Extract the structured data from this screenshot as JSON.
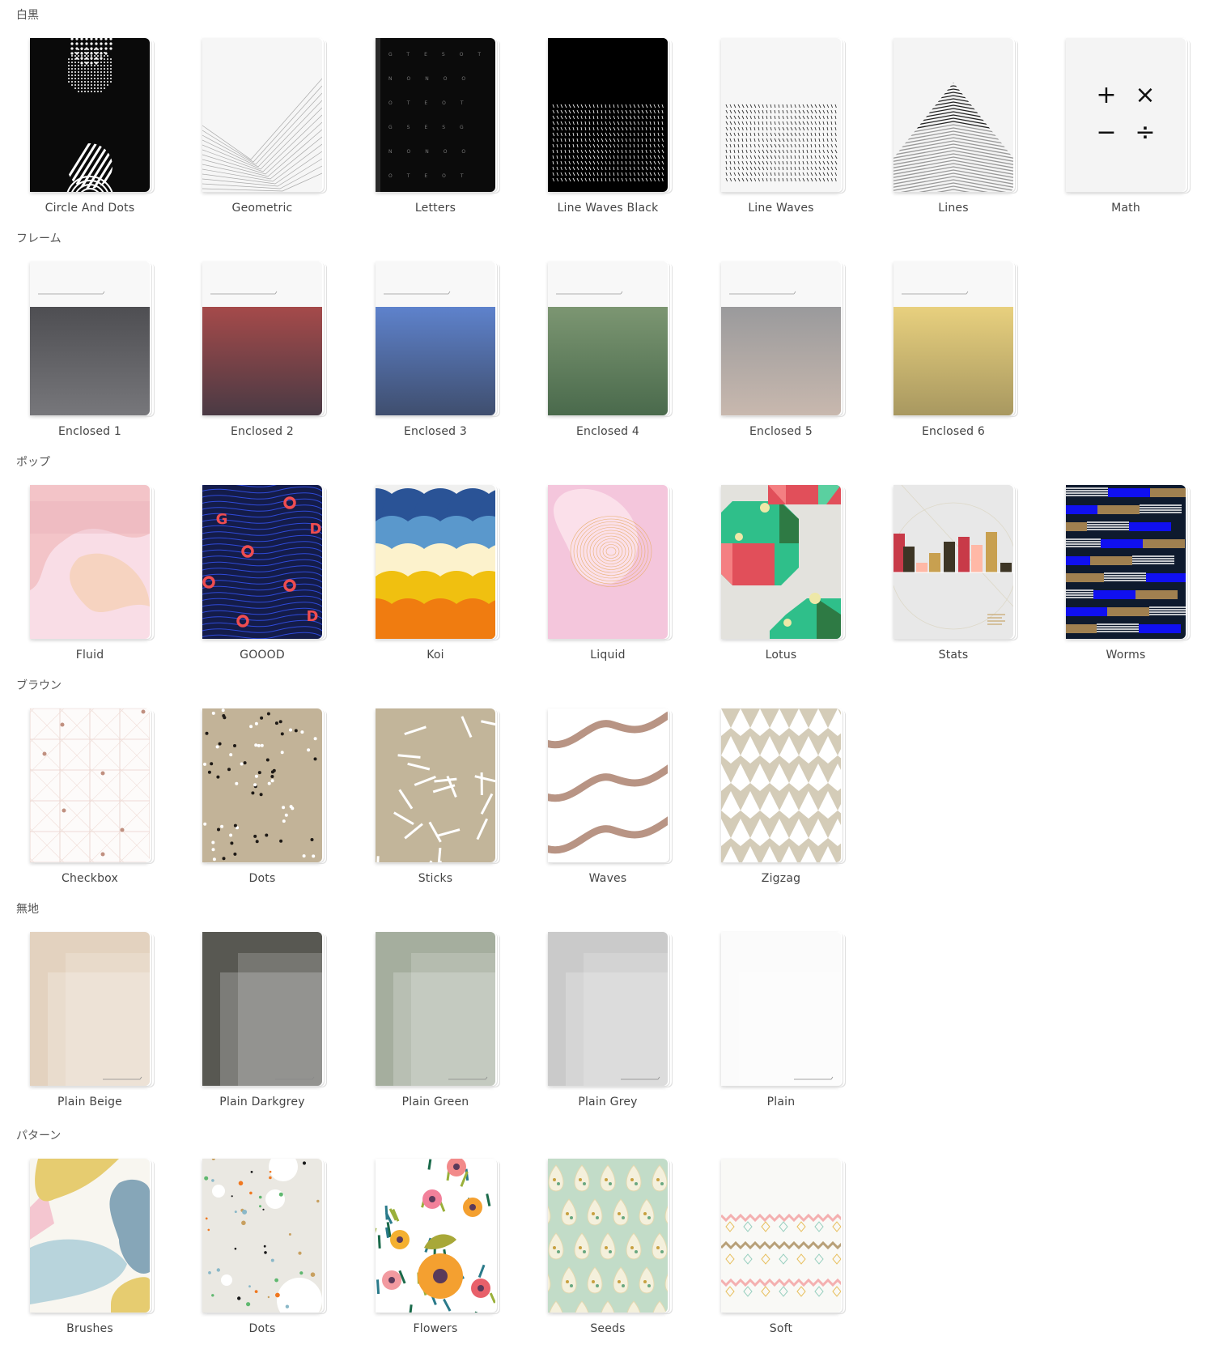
{
  "sections": [
    {
      "title": "白黒",
      "items": [
        "Circle And Dots",
        "Geometric",
        "Letters",
        "Line Waves Black",
        "Line Waves",
        "Lines",
        "Math"
      ]
    },
    {
      "title": "フレーム",
      "items": [
        "Enclosed 1",
        "Enclosed 2",
        "Enclosed 3",
        "Enclosed 4",
        "Enclosed 5",
        "Enclosed 6"
      ]
    },
    {
      "title": "ポップ",
      "items": [
        "Fluid",
        "GOOOD",
        "Koi",
        "Liquid",
        "Lotus",
        "Stats",
        "Worms"
      ]
    },
    {
      "title": "ブラウン",
      "items": [
        "Checkbox",
        "Dots",
        "Sticks",
        "Waves",
        "Zigzag"
      ]
    },
    {
      "title": "無地",
      "items": [
        "Plain Beige",
        "Plain Darkgrey",
        "Plain Green",
        "Plain Grey",
        "Plain"
      ]
    },
    {
      "title": "パターン",
      "items": [
        "Brushes",
        "Dots",
        "Flowers",
        "Seeds",
        "Soft"
      ]
    }
  ],
  "art_glyphs": {
    "math": [
      "+",
      "×",
      "−",
      "÷"
    ],
    "goood": [
      "G",
      "O",
      "D"
    ],
    "letters_rows": [
      "GTESOT",
      "NONOO",
      "OTEOT",
      "GSESG",
      "NONOO",
      "OTEOT"
    ]
  },
  "colors": {
    "enclosed": [
      [
        "#4e4e52",
        "#77777b"
      ],
      [
        "#a54a4a",
        "#4a3a44"
      ],
      [
        "#5e82cc",
        "#3f4e6e"
      ],
      [
        "#7c9672",
        "#4a6a4c"
      ],
      [
        "#9a9a9c",
        "#c8b8ae"
      ],
      [
        "#e8d07e",
        "#a89860"
      ]
    ],
    "plain": [
      "#e3d2bf",
      "#585852",
      "#a5ae9e",
      "#cacaca",
      "#fbfbfb"
    ]
  }
}
